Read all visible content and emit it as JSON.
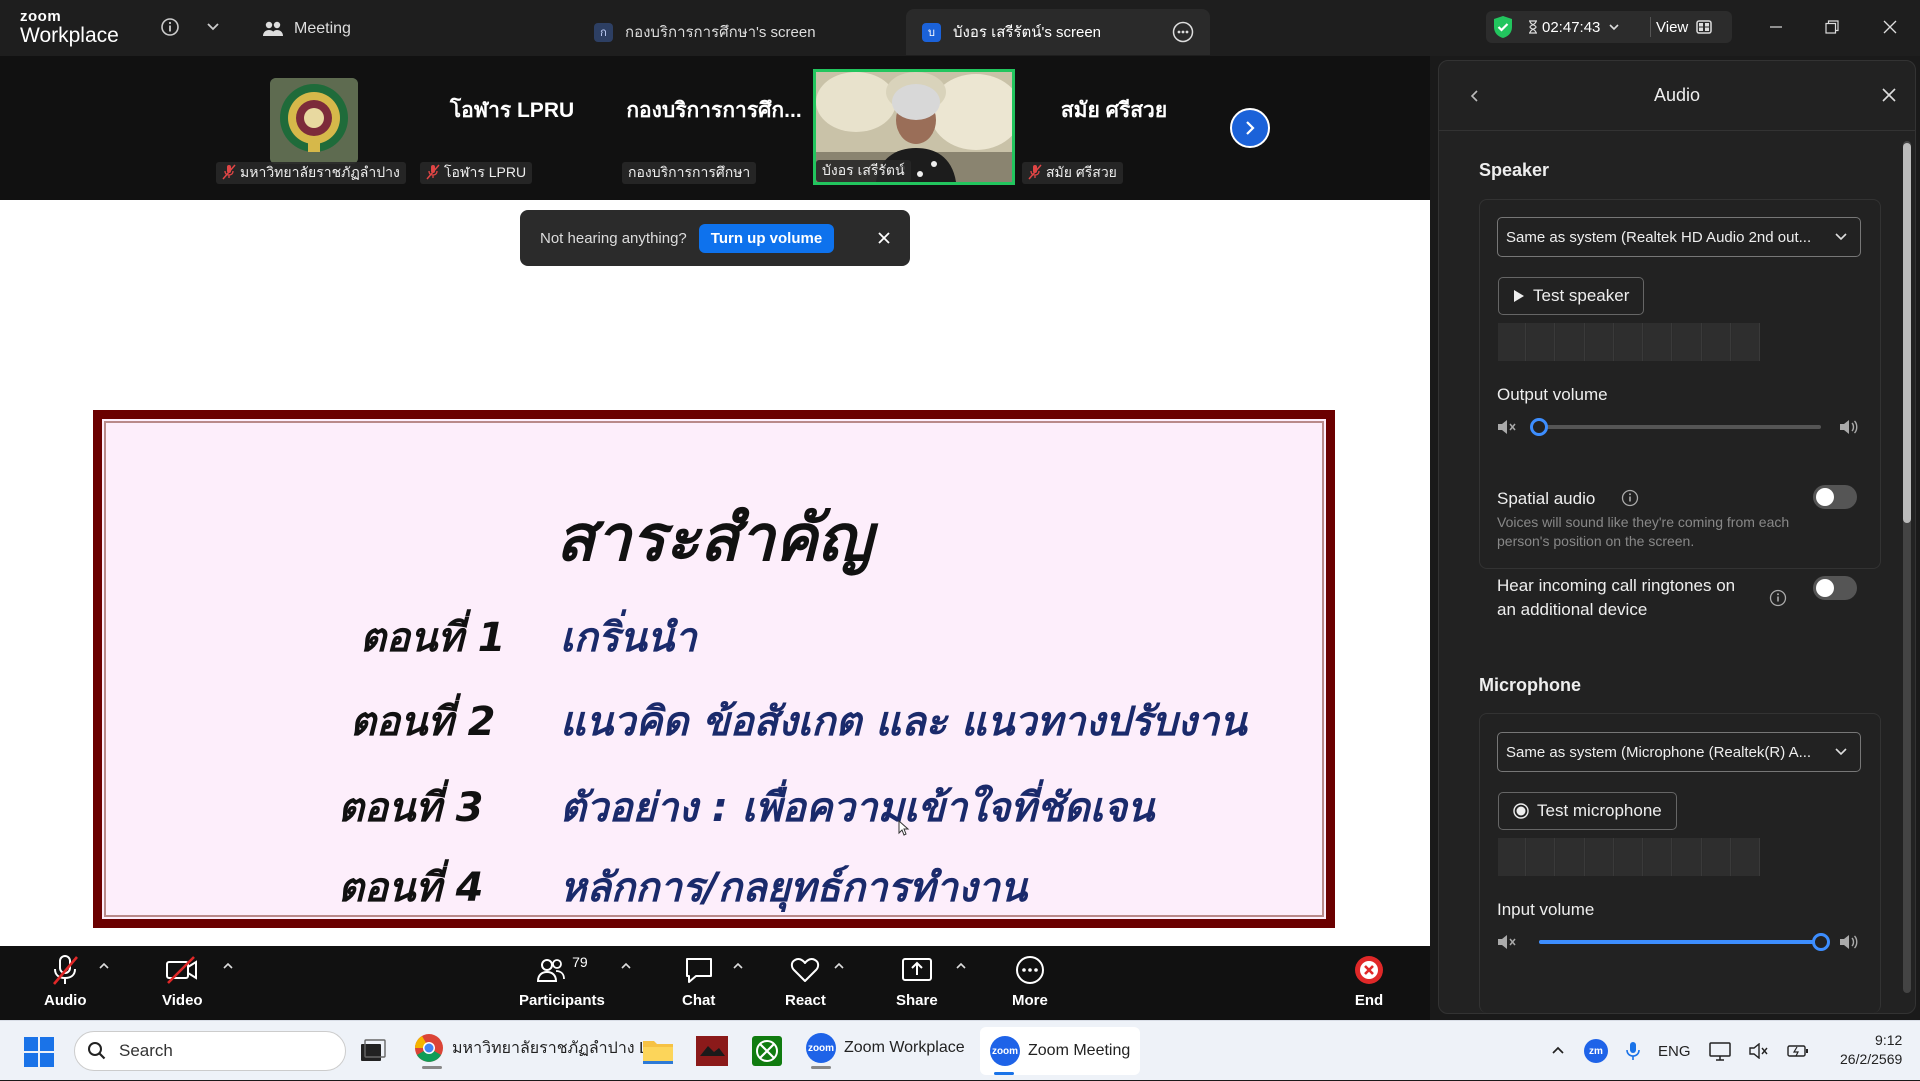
{
  "title_bar": {
    "logo_top": "zoom",
    "logo_bottom": "Workplace",
    "meeting_tab": "Meeting",
    "share_tab_1": {
      "badge": "ก",
      "label": "กองบริการการศึกษา's screen"
    },
    "share_tab_2": {
      "badge": "บ",
      "label": "บังอร เสรีรัตน์'s screen"
    },
    "timer": "02:47:43",
    "view_label": "View"
  },
  "video_strip": {
    "tiles": [
      {
        "type": "logo",
        "label": "มหาวิทยาลัยราชภัฏลำปาง",
        "muted": true
      },
      {
        "type": "name",
        "name": "โอฬาร LPRU",
        "label": "โอฬาร LPRU",
        "muted": true
      },
      {
        "type": "name",
        "name": "กองบริการการศึก...",
        "label": "กองบริการการศึกษา",
        "muted": false
      },
      {
        "type": "video",
        "label": "บังอร เสรีรัตน์",
        "muted": false,
        "active_speaker": true
      },
      {
        "type": "name",
        "name": "สมัย ศรีสวย",
        "label": "สมัย ศรีสวย",
        "muted": true
      }
    ]
  },
  "notice": {
    "text": "Not hearing anything?",
    "button": "Turn up volume"
  },
  "slide": {
    "title": "สาระสำคัญ",
    "rows": [
      {
        "episode": "ตอนที่ 1",
        "topic": "เกริ่นนำ"
      },
      {
        "episode": "ตอนที่ 2",
        "topic": "แนวคิด ข้อสังเกต และ แนวทางปรับงาน"
      },
      {
        "episode": "ตอนที่ 3",
        "topic": "ตัวอย่าง :  เพื่อความเข้าใจที่ชัดเจน"
      },
      {
        "episode": "ตอนที่ 4",
        "topic": "หลักการ/กลยุทธ์การทำงาน"
      }
    ]
  },
  "toolbar": {
    "audio": "Audio",
    "video": "Video",
    "participants": "Participants",
    "participants_count": "79",
    "chat": "Chat",
    "react": "React",
    "share": "Share",
    "more": "More",
    "end": "End"
  },
  "audio_panel": {
    "title": "Audio",
    "speaker": {
      "heading": "Speaker",
      "device": "Same as system (Realtek HD Audio 2nd out...",
      "test_button": "Test speaker",
      "output_volume_label": "Output volume",
      "output_volume": 0
    },
    "spatial_audio": {
      "label": "Spatial audio",
      "description": "Voices will sound like they're coming from each person's position on the screen.",
      "enabled": false
    },
    "ringtones": {
      "label": "Hear incoming call ringtones on an additional device",
      "enabled": false
    },
    "microphone": {
      "heading": "Microphone",
      "device": "Same as system (Microphone (Realtek(R) A...",
      "test_button": "Test microphone",
      "input_volume_label": "Input volume",
      "input_volume": 1.0
    }
  },
  "taskbar": {
    "search_placeholder": "Search",
    "chrome_title": "มหาวิทยาลัยราชภัฏลำปาง Li",
    "zoom_workplace": "Zoom Workplace",
    "zoom_meeting": "Zoom Meeting",
    "zoom_icon_text": "zoom",
    "tray_zm": "zm",
    "language": "ENG",
    "time": "9:12",
    "date": "26/2/2569"
  },
  "colors": {
    "accent": "#0e72ed",
    "slide_border": "#6b0000",
    "slide_bg": "#fdeefb",
    "slide_text": "#1a2a6b",
    "active_speaker": "#22c55e",
    "end_red": "#e02828"
  }
}
